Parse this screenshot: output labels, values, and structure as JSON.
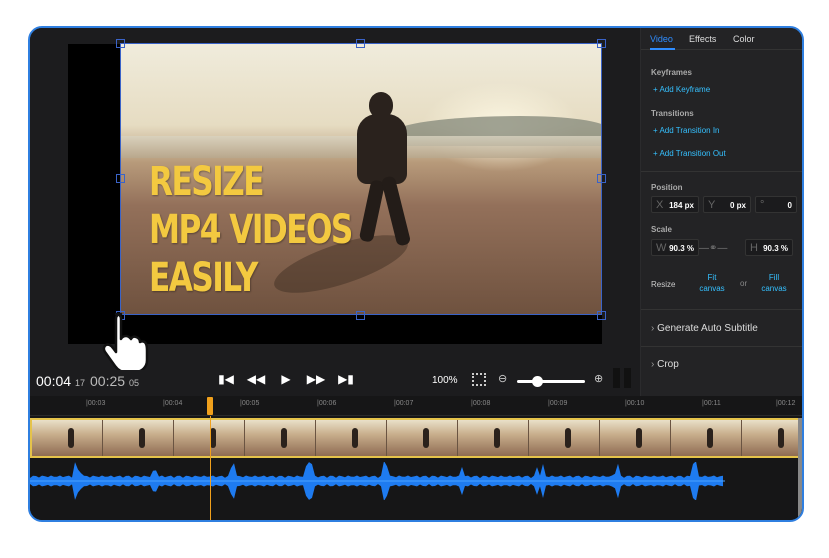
{
  "preview": {
    "headline_lines": [
      "RESIZE",
      "MP4 VIDEOS",
      "EASILY"
    ]
  },
  "playback": {
    "current_time": "00:04",
    "current_frame": "17",
    "total_time": "00:25",
    "total_frame": "05",
    "zoom_percent": "100%",
    "zoom_slider_level": 0.3
  },
  "panel": {
    "tabs": [
      {
        "label": "Video",
        "active": true
      },
      {
        "label": "Effects",
        "active": false
      },
      {
        "label": "Color",
        "active": false
      }
    ],
    "keyframes_heading": "Keyframes",
    "add_keyframe": "+ Add Keyframe",
    "transitions_heading": "Transitions",
    "add_transition_in": "+ Add Transition In",
    "add_transition_out": "+ Add Transition Out",
    "position_heading": "Position",
    "position_x_label": "X",
    "position_x_value": "184 px",
    "position_y_label": "Y",
    "position_y_value": "0 px",
    "rotation_label": "°",
    "rotation_value": "0",
    "scale_heading": "Scale",
    "scale_w_label": "W",
    "scale_w_value": "90.3 %",
    "scale_h_label": "H",
    "scale_h_value": "90.3 %",
    "resize_label": "Resize",
    "fit_canvas": "Fit canvas",
    "or_label": "or",
    "fill_canvas": "Fill canvas",
    "generate_subtitle": "Generate Auto Subtitle",
    "crop": "Crop"
  },
  "timeline": {
    "ticks": [
      "00:03",
      "00:04",
      "00:05",
      "00:06",
      "00:07",
      "00:08",
      "00:09",
      "00:10",
      "00:11",
      "00:12"
    ]
  },
  "colors": {
    "accent": "#2f8dff",
    "link": "#35c0ff",
    "headline": "#f3c940",
    "playhead": "#f0a01c",
    "track_border": "#e5c34a",
    "waveform": "#1e7bf0"
  },
  "icons": {
    "skip_back": "skip-to-start-icon",
    "rewind": "rewind-icon",
    "play": "play-icon",
    "fast_forward": "fast-forward-icon",
    "skip_forward": "skip-to-end-icon",
    "fullscreen": "fullscreen-icon",
    "zoom_out": "zoom-out-icon",
    "zoom_in": "zoom-in-icon",
    "pointer": "hand-pointer-icon"
  }
}
